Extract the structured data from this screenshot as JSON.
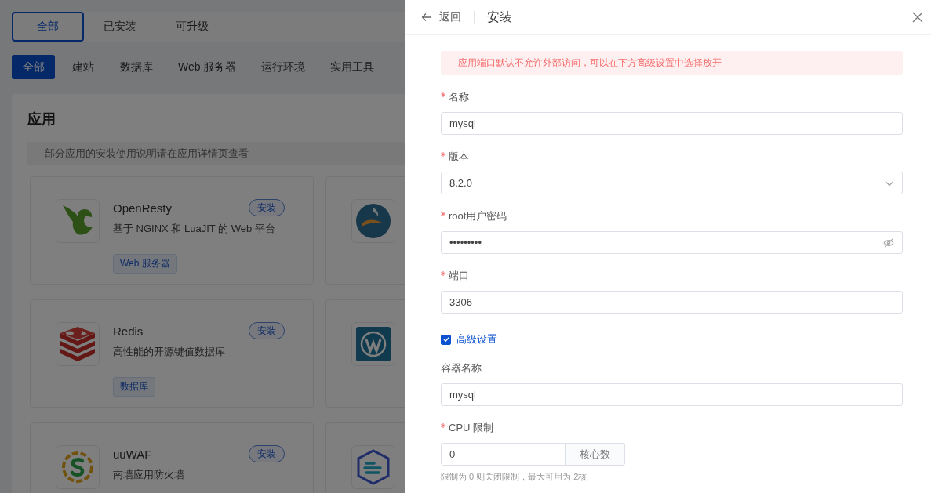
{
  "status_tabs": [
    {
      "label": "全部",
      "selected": true
    },
    {
      "label": "已安装",
      "selected": false
    },
    {
      "label": "可升级",
      "selected": false
    }
  ],
  "category_tabs": [
    {
      "label": "全部",
      "selected": true
    },
    {
      "label": "建站",
      "selected": false
    },
    {
      "label": "数据库",
      "selected": false
    },
    {
      "label": "Web 服务器",
      "selected": false
    },
    {
      "label": "运行环境",
      "selected": false
    },
    {
      "label": "实用工具",
      "selected": false
    }
  ],
  "panel": {
    "title": "应用",
    "notice": "部分应用的安装使用说明请在应用详情页查看"
  },
  "apps": [
    {
      "name": "OpenResty",
      "description": "基于 NGINX 和 LuaJIT 的 Web 平台",
      "button": "安装",
      "tag": "Web 服务器"
    },
    {
      "name": "Redis",
      "description": "高性能的开源键值数据库",
      "button": "安装",
      "tag": "数据库"
    },
    {
      "name": "uuWAF",
      "description": "南墙应用防火墙",
      "button": "安装"
    }
  ],
  "drawer": {
    "back": "返回",
    "title": "安装",
    "alert": "应用端口默认不允许外部访问，可以在下方高级设置中选择放开",
    "fields": [
      {
        "kind": "text",
        "label": "名称",
        "required": true,
        "value": "mysql"
      },
      {
        "kind": "select",
        "label": "版本",
        "required": true,
        "value": "8.2.0"
      },
      {
        "kind": "password",
        "label": "root用户密码",
        "required": true,
        "value": "•••••••••"
      },
      {
        "kind": "text",
        "label": "端口",
        "required": true,
        "value": "3306"
      },
      {
        "kind": "checkbox",
        "label": "高级设置",
        "checked": true
      },
      {
        "kind": "text",
        "label": "容器名称",
        "required": false,
        "value": "mysql"
      },
      {
        "kind": "unit",
        "label": "CPU 限制",
        "required": true,
        "value": "0",
        "unit": "核心数",
        "hint": "限制为 0 则关闭限制，最大可用为 2核"
      }
    ]
  }
}
